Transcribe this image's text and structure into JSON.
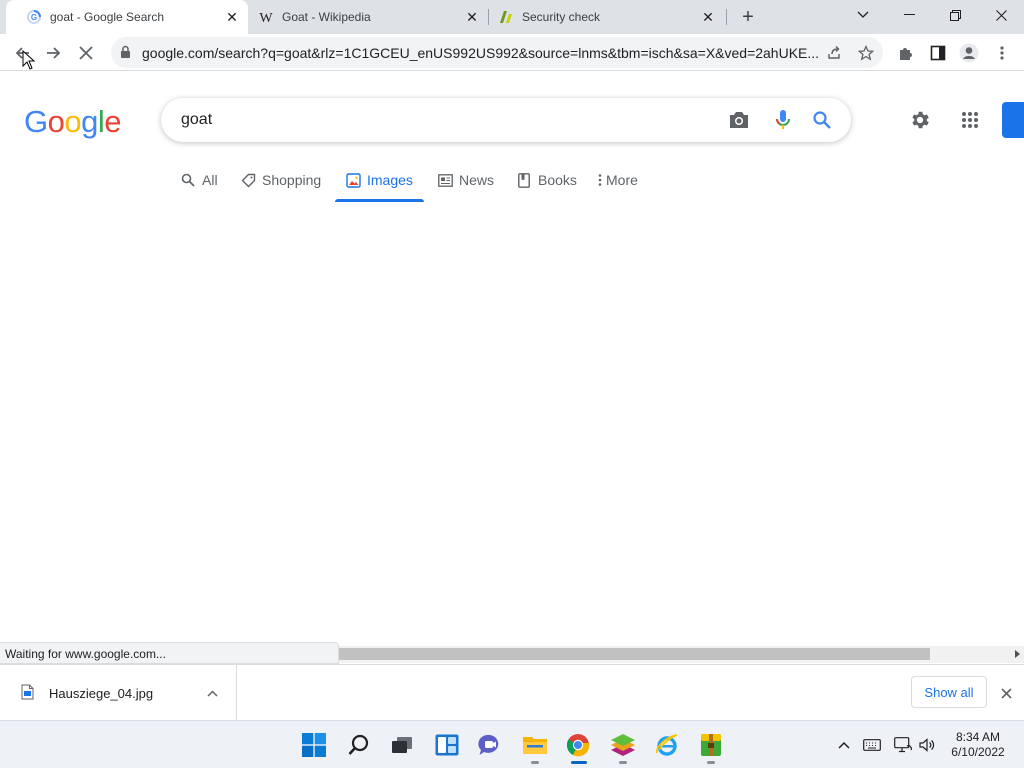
{
  "browser": {
    "tabs": [
      {
        "title": "goat - Google Search",
        "active": true,
        "favicon": "google-loading-icon"
      },
      {
        "title": "Goat - Wikipedia",
        "active": false,
        "favicon": "wikipedia-w-icon"
      },
      {
        "title": "Security check",
        "active": false,
        "favicon": "security-check-icon"
      }
    ],
    "new_tab_glyph": "+",
    "url": "google.com/search?q=goat&rlz=1C1GCEU_enUS992US992&source=lnms&tbm=isch&sa=X&ved=2ahUKE..."
  },
  "google": {
    "logo_letters": [
      {
        "ch": "G",
        "color": "#4285F4"
      },
      {
        "ch": "o",
        "color": "#EA4335"
      },
      {
        "ch": "o",
        "color": "#FBBC05"
      },
      {
        "ch": "g",
        "color": "#4285F4"
      },
      {
        "ch": "l",
        "color": "#34A853"
      },
      {
        "ch": "e",
        "color": "#EA4335"
      }
    ],
    "query": "goat",
    "search_tabs": [
      {
        "label": "All",
        "icon": "search-icon"
      },
      {
        "label": "Shopping",
        "icon": "tag-icon"
      },
      {
        "label": "Images",
        "icon": "image-icon",
        "active": true
      },
      {
        "label": "News",
        "icon": "news-icon"
      },
      {
        "label": "Books",
        "icon": "book-icon"
      },
      {
        "label": "More",
        "icon": "more-vert-icon"
      }
    ]
  },
  "status_text": "Waiting for www.google.com...",
  "download": {
    "filename": "Hausziege_04.jpg",
    "show_all_label": "Show all"
  },
  "taskbar": {
    "time": "8:34 AM",
    "date": "6/10/2022"
  },
  "colors": {
    "accent_blue": "#1a73e8",
    "tab_strip": "#dee1e6",
    "taskbar": "#eef1f6"
  }
}
